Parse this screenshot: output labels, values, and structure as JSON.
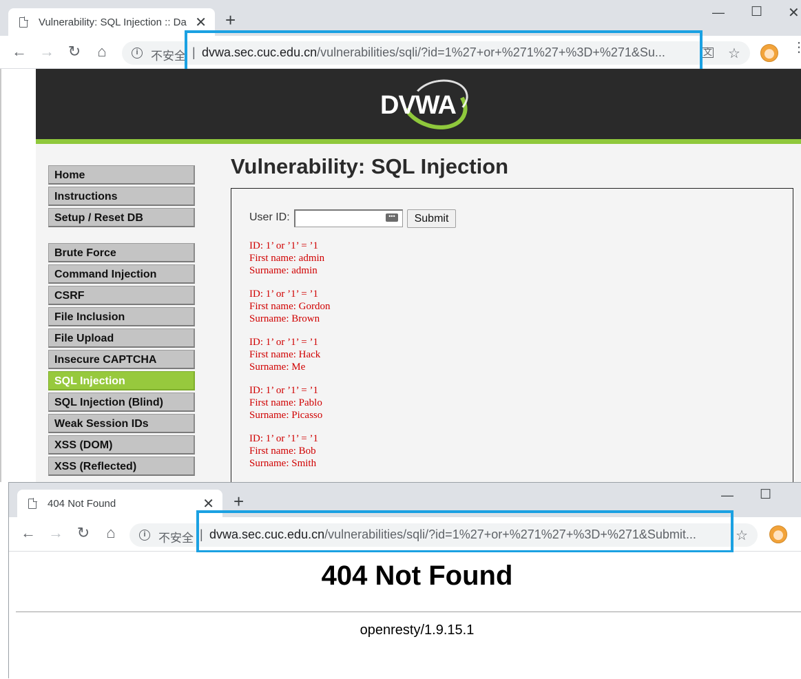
{
  "win1": {
    "tab_title": "Vulnerability: SQL Injection :: Da",
    "omnibox": {
      "insecure_label": "不安全",
      "separator": "|",
      "url_host": "dvwa.sec.cuc.edu.cn",
      "url_path": "/vulnerabilities/sqli/?id=1%27+or+%271%27+%3D+%271&Su..."
    }
  },
  "dvwa": {
    "logo_text": "DVWA",
    "menu_group1": [
      "Home",
      "Instructions",
      "Setup / Reset DB"
    ],
    "menu_group2": [
      "Brute Force",
      "Command Injection",
      "CSRF",
      "File Inclusion",
      "File Upload",
      "Insecure CAPTCHA",
      "SQL Injection",
      "SQL Injection (Blind)",
      "Weak Session IDs",
      "XSS (DOM)",
      "XSS (Reflected)"
    ],
    "active_item": "SQL Injection",
    "heading": "Vulnerability: SQL Injection",
    "form": {
      "user_id_label": "User ID:",
      "input_value": "",
      "submit_label": "Submit"
    },
    "results": [
      {
        "id": "ID: 1’ or ’1’ = ’1",
        "first": "First name: admin",
        "surname": "Surname: admin"
      },
      {
        "id": "ID: 1’ or ’1’ = ’1",
        "first": "First name: Gordon",
        "surname": "Surname: Brown"
      },
      {
        "id": "ID: 1’ or ’1’ = ’1",
        "first": "First name: Hack",
        "surname": "Surname: Me"
      },
      {
        "id": "ID: 1’ or ’1’ = ’1",
        "first": "First name: Pablo",
        "surname": "Surname: Picasso"
      },
      {
        "id": "ID: 1’ or ’1’ = ’1",
        "first": "First name: Bob",
        "surname": "Surname: Smith"
      }
    ]
  },
  "win2": {
    "tab_title": "404 Not Found",
    "omnibox": {
      "insecure_label": "不安全",
      "separator": "|",
      "url_host": "dvwa.sec.cuc.edu.cn",
      "url_path": "/vulnerabilities/sqli/?id=1%27+or+%271%27+%3D+%271&Submit..."
    },
    "heading": "404 Not Found",
    "server": "openresty/1.9.15.1"
  },
  "colors": {
    "highlight": "#1ba1e2",
    "dvwa_green": "#97c93d",
    "result_red": "#d00000"
  }
}
